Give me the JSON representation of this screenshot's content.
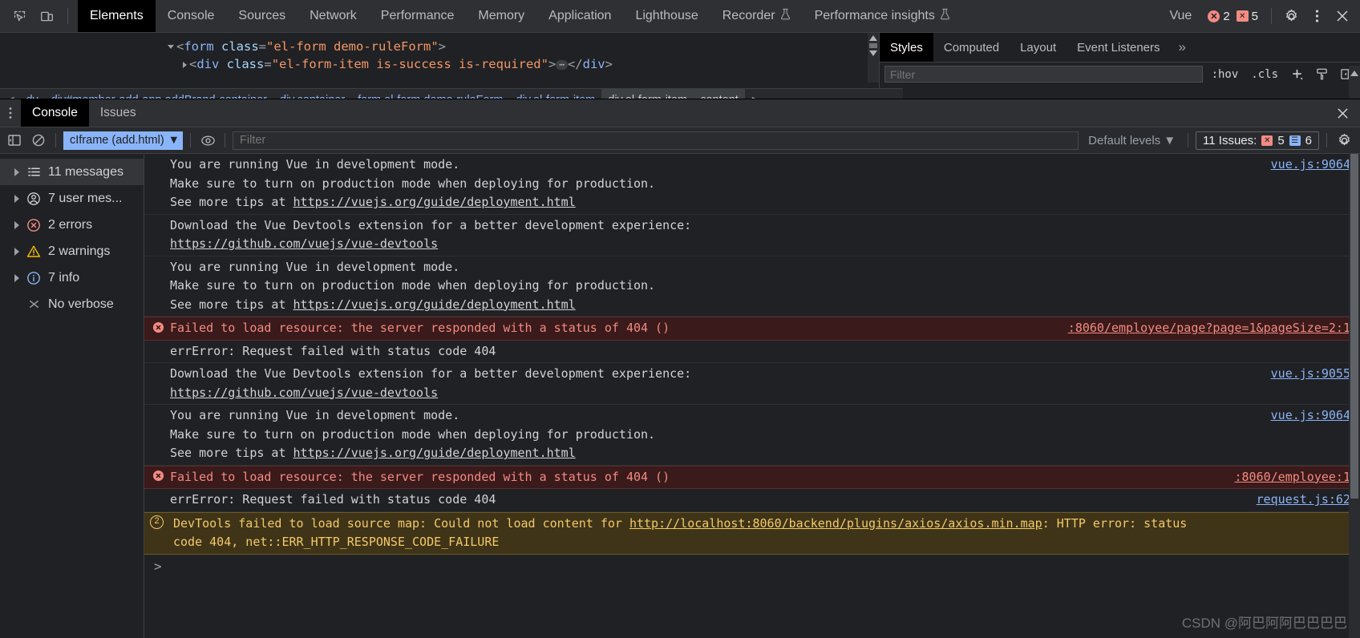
{
  "topbar": {
    "icons": [
      {
        "name": "inspect-element-icon"
      },
      {
        "name": "device-toolbar-icon"
      }
    ],
    "tabs": [
      {
        "label": "Elements",
        "active": true,
        "flask": false
      },
      {
        "label": "Console",
        "active": false,
        "flask": false
      },
      {
        "label": "Sources",
        "active": false,
        "flask": false
      },
      {
        "label": "Network",
        "active": false,
        "flask": false
      },
      {
        "label": "Performance",
        "active": false,
        "flask": false
      },
      {
        "label": "Memory",
        "active": false,
        "flask": false
      },
      {
        "label": "Application",
        "active": false,
        "flask": false
      },
      {
        "label": "Lighthouse",
        "active": false,
        "flask": false
      },
      {
        "label": "Recorder",
        "active": false,
        "flask": true
      },
      {
        "label": "Performance insights",
        "active": false,
        "flask": true
      }
    ],
    "vue_label": "Vue",
    "error_count": "2",
    "message_count": "5",
    "settings_icon": "gear-icon",
    "more_icon": "kebab-icon",
    "close_icon": "close-icon"
  },
  "elements": {
    "dom_lines": [
      {
        "indent": 0,
        "triangle": "open",
        "parts": [
          {
            "t": "<",
            "c": "pl"
          },
          {
            "t": "form",
            "c": "tg"
          },
          {
            "t": " class",
            "c": "at"
          },
          {
            "t": "=",
            "c": "pl"
          },
          {
            "t": "\"el-form demo-ruleForm\"",
            "c": "av"
          },
          {
            "t": ">",
            "c": "pl"
          }
        ]
      },
      {
        "indent": 1,
        "triangle": "closed",
        "parts": [
          {
            "t": "<",
            "c": "pl"
          },
          {
            "t": "div",
            "c": "tg"
          },
          {
            "t": " class",
            "c": "at"
          },
          {
            "t": "=",
            "c": "pl"
          },
          {
            "t": "\"el-form-item is-success is-required\"",
            "c": "av"
          },
          {
            "t": ">",
            "c": "pl"
          },
          {
            "t": "ELLIPSIS",
            "c": "ellip"
          },
          {
            "t": "</",
            "c": "pl"
          },
          {
            "t": "div",
            "c": "tg"
          },
          {
            "t": ">",
            "c": "pl"
          }
        ]
      }
    ],
    "breadcrumb": {
      "back_arrow": "chevron-left-icon",
      "items": [
        {
          "label": "dy",
          "selected": false
        },
        {
          "label": "div#member-add-app.addBrand-container",
          "selected": false
        },
        {
          "label": "div.container",
          "selected": false
        },
        {
          "label": "form.el-form.demo-ruleForm",
          "selected": false
        },
        {
          "label": "div.el-form-item",
          "selected": false
        },
        {
          "label": "div.el-form-item__content",
          "selected": true
        }
      ],
      "forward_arrow": "chevron-right-icon"
    }
  },
  "styles_pane": {
    "tabs": [
      {
        "label": "Styles",
        "active": true
      },
      {
        "label": "Computed",
        "active": false
      },
      {
        "label": "Layout",
        "active": false
      },
      {
        "label": "Event Listeners",
        "active": false
      }
    ],
    "more_label": "»",
    "filter_placeholder": "Filter",
    "hov_label": ":hov",
    "cls_label": ".cls",
    "new_rule_icon": "plus-icon",
    "class_icon": "paintbrush-icon",
    "sidebar_toggle_icon": "panel-toggle-icon"
  },
  "drawer": {
    "kebab_icon": "kebab-icon",
    "tabs": [
      {
        "label": "Console",
        "active": true
      },
      {
        "label": "Issues",
        "active": false
      }
    ],
    "close_icon": "close-icon"
  },
  "console_toolbar": {
    "sidebar_toggle_icon": "console-sidebar-icon",
    "clear_icon": "clear-console-icon",
    "context_value": "cIframe (add.html)",
    "eye_icon": "live-expression-icon",
    "filter_placeholder": "Filter",
    "levels_label": "Default levels",
    "issues_label": "11 Issues:",
    "issues_error_count": "5",
    "issues_info_count": "6",
    "settings_icon": "gear-icon"
  },
  "console_sidebar": {
    "items": [
      {
        "label": "11 messages",
        "icon": "list-icon",
        "selected": true
      },
      {
        "label": "7 user mes...",
        "icon": "person-icon",
        "selected": false
      },
      {
        "label": "2 errors",
        "icon": "error-circle-icon",
        "selected": false
      },
      {
        "label": "2 warnings",
        "icon": "warning-triangle-icon",
        "selected": false
      },
      {
        "label": "7 info",
        "icon": "info-circle-icon",
        "selected": false
      },
      {
        "label": "No verbose",
        "icon": "verbose-icon",
        "selected": false
      }
    ]
  },
  "console_messages": [
    {
      "level": "plain",
      "source": "vue.js:9064",
      "lines": [
        [
          {
            "t": "You are running Vue in development mode."
          }
        ],
        [
          {
            "t": "Make sure to turn on production mode when deploying for production."
          }
        ],
        [
          {
            "t": "See more tips at "
          },
          {
            "t": "https://vuejs.org/guide/deployment.html",
            "link": true
          }
        ]
      ]
    },
    {
      "level": "plain",
      "source": "",
      "lines": [
        [
          {
            "t": "Download the Vue Devtools extension for a better development experience:"
          }
        ],
        [
          {
            "t": "https://github.com/vuejs/vue-devtools",
            "link": true
          }
        ]
      ]
    },
    {
      "level": "plain",
      "source": "",
      "lines": [
        [
          {
            "t": "You are running Vue in development mode."
          }
        ],
        [
          {
            "t": "Make sure to turn on production mode when deploying for production."
          }
        ],
        [
          {
            "t": "See more tips at "
          },
          {
            "t": "https://vuejs.org/guide/deployment.html",
            "link": true
          }
        ]
      ]
    },
    {
      "level": "error",
      "source": ":8060/employee/page?page=1&pageSize=2:1",
      "reload_icon": true,
      "lines": [
        [
          {
            "t": "Failed to load resource: the server responded with a status of 404 ()"
          }
        ]
      ]
    },
    {
      "level": "plain",
      "source": "",
      "lines": [
        [
          {
            "t": "errError: Request failed with status code 404"
          }
        ]
      ]
    },
    {
      "level": "plain",
      "source": "vue.js:9055",
      "lines": [
        [
          {
            "t": "Download the Vue Devtools extension for a better development experience:"
          }
        ],
        [
          {
            "t": "https://github.com/vuejs/vue-devtools",
            "link": true
          }
        ]
      ]
    },
    {
      "level": "plain",
      "source": "vue.js:9064",
      "lines": [
        [
          {
            "t": "You are running Vue in development mode."
          }
        ],
        [
          {
            "t": "Make sure to turn on production mode when deploying for production."
          }
        ],
        [
          {
            "t": "See more tips at "
          },
          {
            "t": "https://vuejs.org/guide/deployment.html",
            "link": true
          }
        ]
      ]
    },
    {
      "level": "error",
      "source": ":8060/employee:1",
      "reload_icon": true,
      "lines": [
        [
          {
            "t": "Failed to load resource: the server responded with a status of 404 ()"
          }
        ]
      ]
    },
    {
      "level": "plain",
      "source": "request.js:62",
      "lines": [
        [
          {
            "t": "errError: Request failed with status code 404"
          }
        ]
      ]
    },
    {
      "level": "warning",
      "badge": "2",
      "source": "",
      "lines": [
        [
          {
            "t": "DevTools failed to load source map: Could not load content for "
          },
          {
            "t": "http://localhost:8060/backend/plugins/axios/axios.min.map",
            "link": true
          },
          {
            "t": ": HTTP error: status"
          }
        ],
        [
          {
            "t": "code 404, net::ERR_HTTP_RESPONSE_CODE_FAILURE"
          }
        ]
      ]
    }
  ],
  "console_prompt": {
    "caret": ">"
  },
  "watermark": "CSDN @阿巴阿阿巴巴巴巴"
}
